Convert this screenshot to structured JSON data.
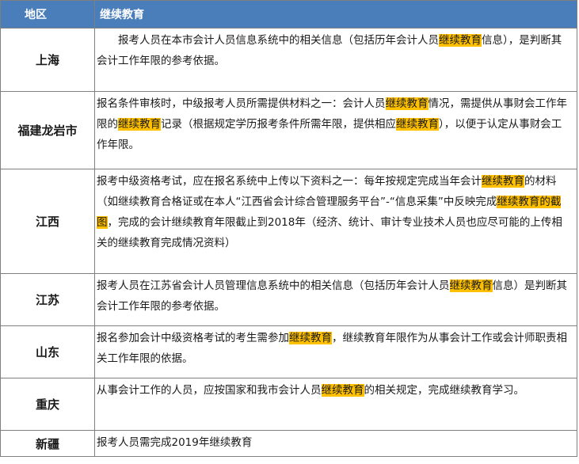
{
  "header": {
    "region": "地区",
    "content": "继续教育"
  },
  "rows": [
    {
      "region": "上海",
      "segments": [
        "报考人员在本市会计人员信息系统中的相关信息（包括历年会计人员",
        "继续教育",
        "信息），是判断其会计工作年限的参考依据。"
      ]
    },
    {
      "region": "福建龙岩市",
      "segments": [
        "报名条件审核时，中级报考人员所需提供材料之一：会计人员",
        "继续教育",
        "情况，需提供从事财会工作年限的",
        "继续教育",
        "记录（根据规定学历报考条件所需年限，提供相应",
        "继续教育",
        "），以便于认定从事财会工作年限。"
      ]
    },
    {
      "region": "江西",
      "segments": [
        "报考中级资格考试，应在报名系统中上传以下资料之一：每年按规定完成当年会计",
        "继续教育",
        "的材料（如继续教育合格证或在本人“江西省会计综合管理服务平台”-“信息采集”中反映完成",
        "继续教育的截图",
        "，完成的会计继续教育年限截止到2018年（经济、统计、审计专业技术人员也应尽可能的上传相关的继续教育完成情况资料）"
      ]
    },
    {
      "region": "江苏",
      "segments": [
        "报考人员在江苏省会计人员管理信息系统中的相关信息（包括历年会计人员",
        "继续教育",
        "信息）是判断其会计工作年限的参考依据。"
      ]
    },
    {
      "region": "山东",
      "segments": [
        "报名参加会计中级资格考试的考生需参加",
        "继续教育",
        "，继续教育年限作为从事会计工作或会计师职责相关工作年限的依据。"
      ]
    },
    {
      "region": "重庆",
      "segments": [
        "从事会计工作的人员，应按国家和我市会计人员",
        "继续教育",
        "的相关规定，完成继续教育学习。"
      ]
    },
    {
      "region": "新疆",
      "segments": [
        "报考人员需完成2019年继续教育"
      ]
    }
  ],
  "colors": {
    "header_bg": "#4a7ebb",
    "highlight": "#ffc000",
    "border": "#7f7f7f"
  }
}
